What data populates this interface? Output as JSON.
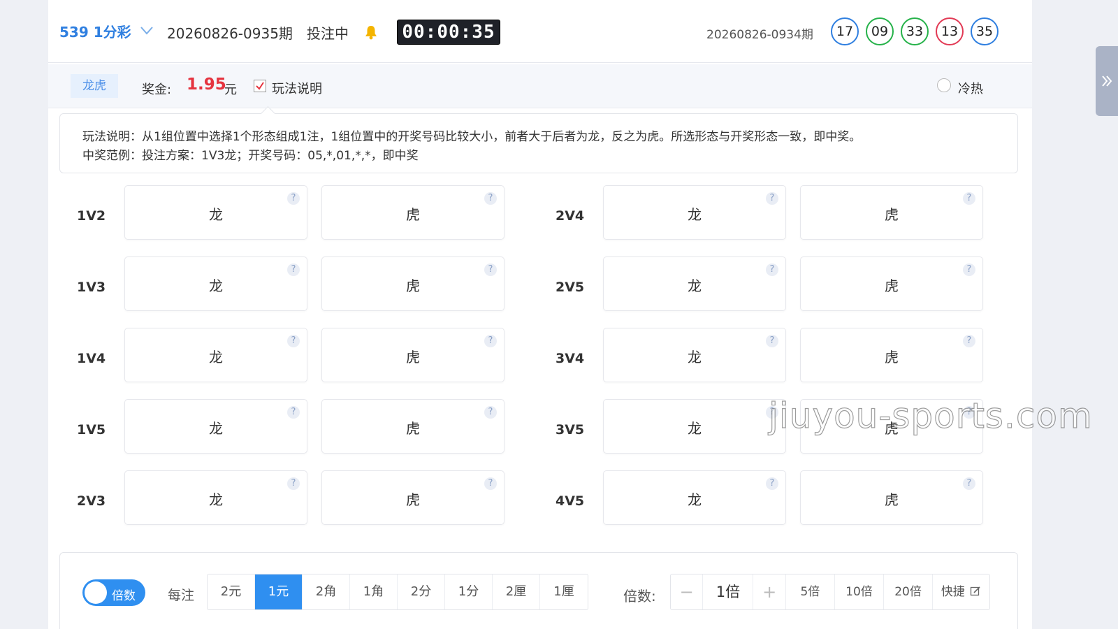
{
  "header": {
    "game_name": "539 1分彩",
    "period": "20260826-0935期",
    "status": "投注中",
    "timer": "00:00:35",
    "last_period": "20260826-0934期",
    "balls": [
      {
        "num": "17",
        "color": "#2f7fe0"
      },
      {
        "num": "09",
        "color": "#26b24a"
      },
      {
        "num": "33",
        "color": "#26b24a"
      },
      {
        "num": "13",
        "color": "#e23a55"
      },
      {
        "num": "35",
        "color": "#2f7fe0"
      }
    ]
  },
  "tabbar": {
    "tab": "龙虎",
    "prize_label": "奖金:",
    "prize_value": "1.95",
    "prize_unit": "元",
    "rule_label": "玩法说明",
    "hot_label": "冷热"
  },
  "explain": {
    "line1": "玩法说明：从1组位置中选择1个形态组成1注，1组位置中的开奖号码比较大小，前者大于后者为龙，反之为虎。所选形态与开奖形态一致，即中奖。",
    "line2": "中奖范例：投注方案：1V3龙；开奖号码：05,*,01,*,*，即中奖"
  },
  "grid": {
    "dragon": "龙",
    "tiger": "虎",
    "help": "?",
    "left_labels": [
      "1V2",
      "1V3",
      "1V4",
      "1V5",
      "2V3"
    ],
    "right_labels": [
      "2V4",
      "2V5",
      "3V4",
      "3V5",
      "4V5"
    ]
  },
  "bottom": {
    "toggle_label": "倍数",
    "per_label": "每注",
    "units": [
      "2元",
      "1元",
      "2角",
      "1角",
      "2分",
      "1分",
      "2厘",
      "1厘"
    ],
    "active_unit": "1元",
    "mult_label": "倍数:",
    "minus": "−",
    "mult_value": "1倍",
    "plus": "+",
    "quick": [
      "5倍",
      "10倍",
      "20倍"
    ],
    "shortcut": "快捷"
  },
  "watermark": "jiuyou-sports.com",
  "icons": {
    "chevron": "chevron-down-icon",
    "bell": "bell-icon",
    "check": "check-icon",
    "side": "double-chevron-right-icon",
    "edit": "edit-icon"
  }
}
